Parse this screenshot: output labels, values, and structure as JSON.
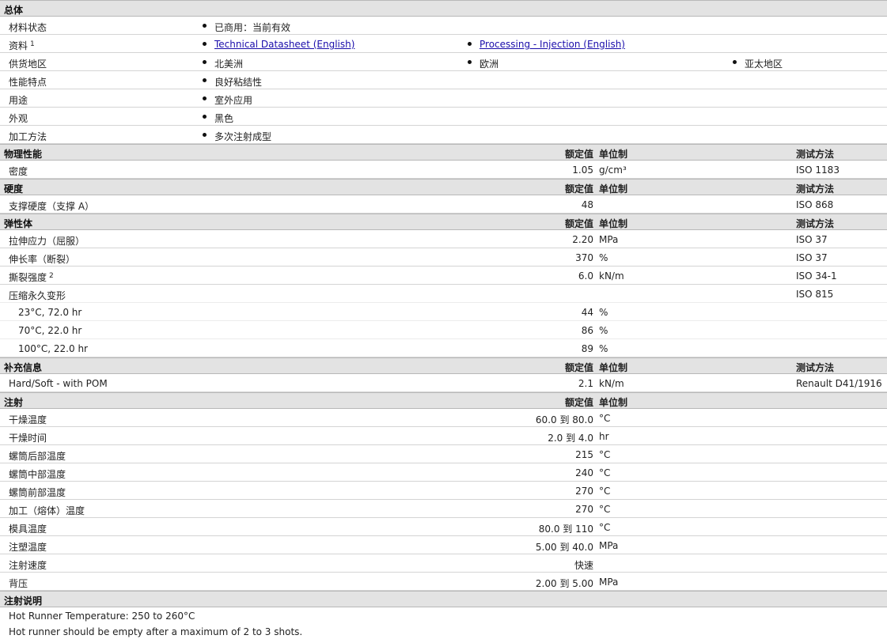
{
  "general": {
    "title": "总体",
    "material_status": {
      "label": "材料状态",
      "value": "已商用：当前有效"
    },
    "literature": {
      "label": "资料",
      "sup": "1",
      "links": [
        "Technical Datasheet (English)",
        "Processing - Injection (English)"
      ]
    },
    "availability": {
      "label": "供货地区",
      "regions": [
        "北美洲",
        "欧洲",
        "亚太地区"
      ]
    },
    "features": {
      "label": "性能特点",
      "value": "良好粘结性"
    },
    "uses": {
      "label": "用途",
      "value": "室外应用"
    },
    "appearance": {
      "label": "外观",
      "value": "黑色"
    },
    "processing_method": {
      "label": "加工方法",
      "value": "多次注射成型"
    }
  },
  "columns": {
    "nominal": "额定值",
    "unit": "单位制",
    "test": "测试方法"
  },
  "physical": {
    "title": "物理性能",
    "rows": [
      {
        "label": "密度",
        "value": "1.05",
        "unit": "g/cm³",
        "test": "ISO 1183"
      }
    ]
  },
  "hardness": {
    "title": "硬度",
    "rows": [
      {
        "label": "支撑硬度（支撑 A）",
        "value": "48",
        "unit": "",
        "test": "ISO 868"
      }
    ]
  },
  "elastomer": {
    "title": "弹性体",
    "rows": [
      {
        "label": "拉伸应力（屈服）",
        "value": "2.20",
        "unit": "MPa",
        "test": "ISO 37"
      },
      {
        "label": "伸长率（断裂）",
        "value": "370",
        "unit": "%",
        "test": "ISO 37"
      },
      {
        "label": "撕裂强度",
        "sup": "2",
        "value": "6.0",
        "unit": "kN/m",
        "test": "ISO 34-1"
      },
      {
        "label": "压缩永久变形",
        "value": "",
        "unit": "",
        "test": "ISO 815"
      }
    ],
    "sub_rows": [
      {
        "label": "23°C, 72.0 hr",
        "value": "44",
        "unit": "%"
      },
      {
        "label": "70°C, 22.0 hr",
        "value": "86",
        "unit": "%"
      },
      {
        "label": "100°C, 22.0 hr",
        "value": "89",
        "unit": "%"
      }
    ]
  },
  "supplemental": {
    "title": "补充信息",
    "rows": [
      {
        "label": "Hard/Soft - with POM",
        "value": "2.1",
        "unit": "kN/m",
        "test": "Renault D41/1916"
      }
    ]
  },
  "injection": {
    "title": "注射",
    "rows": [
      {
        "label": "干燥温度",
        "value": "60.0 到  80.0",
        "unit": "°C"
      },
      {
        "label": "干燥时间",
        "value": "2.0 到  4.0",
        "unit": "hr"
      },
      {
        "label": "螺筒后部温度",
        "value": "215",
        "unit": "°C"
      },
      {
        "label": "螺筒中部温度",
        "value": "240",
        "unit": "°C"
      },
      {
        "label": "螺筒前部温度",
        "value": "270",
        "unit": "°C"
      },
      {
        "label": "加工（熔体）温度",
        "value": "270",
        "unit": "°C"
      },
      {
        "label": "模具温度",
        "value": "80.0 到  110",
        "unit": "°C"
      },
      {
        "label": "注塑温度",
        "value": "5.00 到  40.0",
        "unit": "MPa"
      },
      {
        "label": "注射速度",
        "value": "快速",
        "unit": ""
      },
      {
        "label": "背压",
        "value": "2.00 到  5.00",
        "unit": "MPa"
      }
    ]
  },
  "injection_notes": {
    "title": "注射说明",
    "lines": [
      "Hot Runner Temperature: 250 to 260°C",
      "Hot runner should be empty after a maximum of 2 to 3 shots."
    ]
  }
}
